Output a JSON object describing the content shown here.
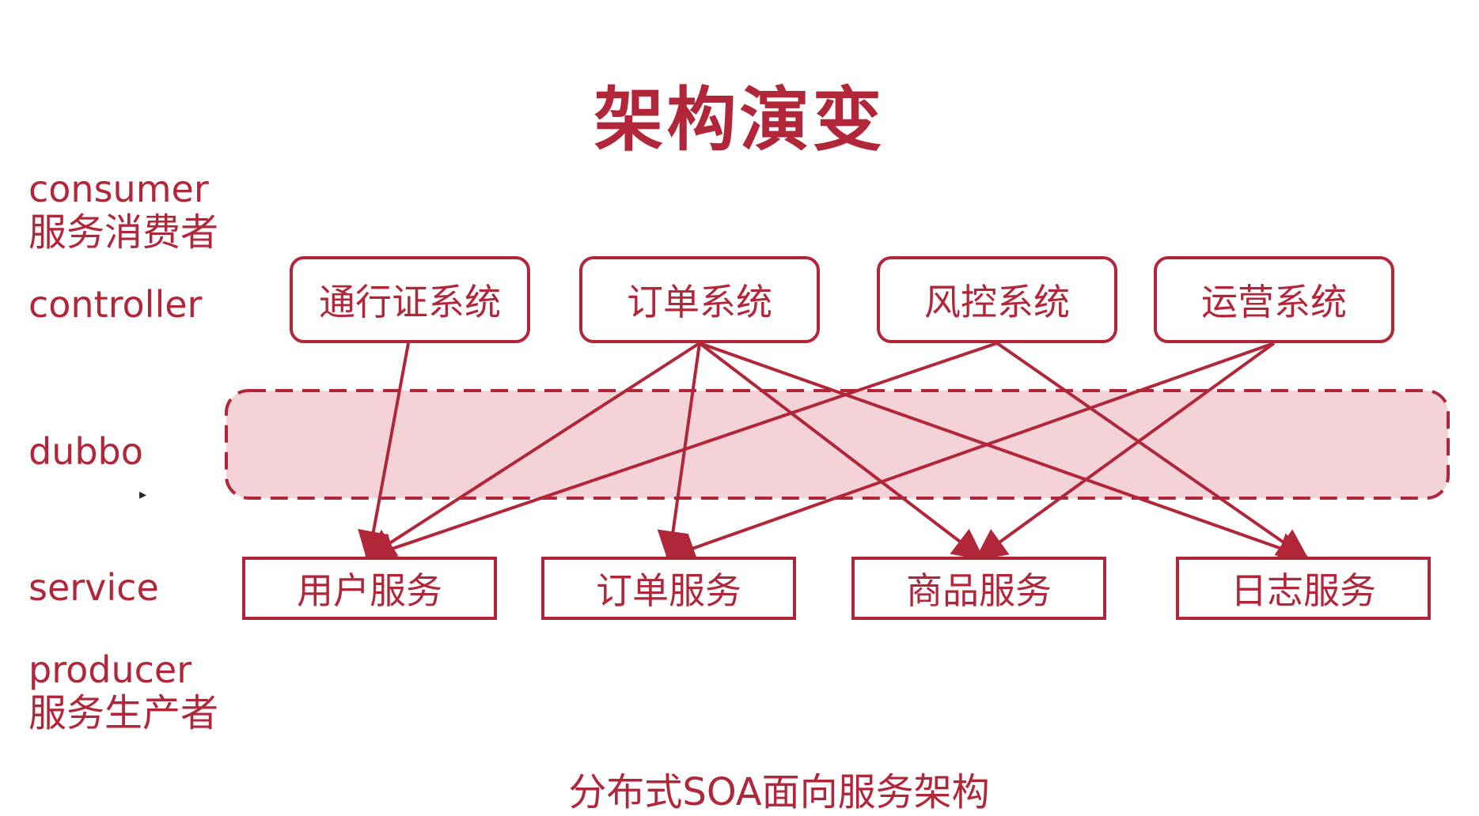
{
  "title": "架构演变",
  "caption": "分布式SOA面向服务架构",
  "layers": {
    "consumer": {
      "en": "consumer",
      "zh": "服务消费者"
    },
    "controller": {
      "en": "controller"
    },
    "dubbo": {
      "en": "dubbo"
    },
    "service": {
      "en": "service"
    },
    "producer": {
      "en": "producer",
      "zh": "服务生产者"
    }
  },
  "controllers": [
    "通行证系统",
    "订单系统",
    "风控系统",
    "运营系统"
  ],
  "services": [
    "用户服务",
    "订单服务",
    "商品服务",
    "日志服务"
  ],
  "connections": [
    {
      "from": 0,
      "to": 0
    },
    {
      "from": 1,
      "to": 0
    },
    {
      "from": 1,
      "to": 1
    },
    {
      "from": 1,
      "to": 2
    },
    {
      "from": 1,
      "to": 3
    },
    {
      "from": 2,
      "to": 0
    },
    {
      "from": 2,
      "to": 3
    },
    {
      "from": 3,
      "to": 1
    },
    {
      "from": 3,
      "to": 2
    }
  ],
  "colors": {
    "accent": "#b2263a",
    "dubbo_fill": "#f3d3d7"
  }
}
